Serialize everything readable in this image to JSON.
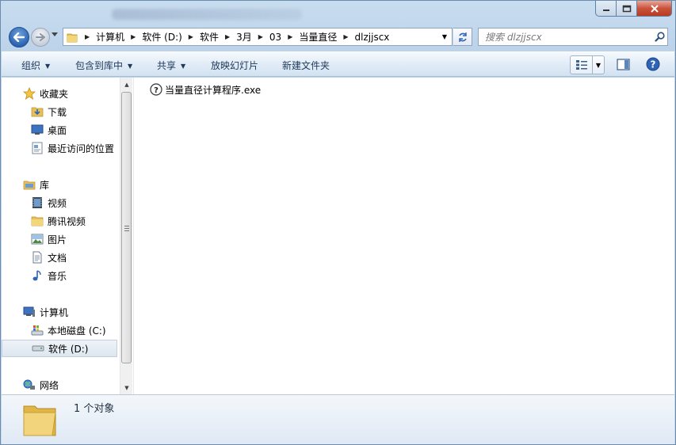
{
  "window": {
    "caption_buttons": {
      "minimize": "minimize-icon",
      "maximize": "maximize-icon",
      "close": "close-icon"
    }
  },
  "address": {
    "crumbs": [
      "计算机",
      "软件 (D:)",
      "软件",
      "3月",
      "03",
      "当量直径",
      "dlzjjscx"
    ]
  },
  "search": {
    "placeholder": "搜索 dlzjjscx"
  },
  "toolbar": {
    "organize": "组织",
    "include_in_library": "包含到库中",
    "share": "共享",
    "slideshow": "放映幻灯片",
    "new_folder": "新建文件夹"
  },
  "navpane": {
    "favorites": {
      "label": "收藏夹",
      "items": [
        "下载",
        "桌面",
        "最近访问的位置"
      ]
    },
    "libraries": {
      "label": "库",
      "items": [
        "视频",
        "腾讯视频",
        "图片",
        "文档",
        "音乐"
      ]
    },
    "computer": {
      "label": "计算机",
      "items": [
        "本地磁盘 (C:)",
        "软件 (D:)"
      ],
      "selected": "软件 (D:)"
    },
    "network": {
      "label": "网络"
    }
  },
  "files": [
    {
      "name": "当量直径计算程序.exe",
      "icon": "help-question-icon"
    }
  ],
  "details": {
    "count_text": "1 个对象"
  },
  "colors": {
    "accent": "#1e395b",
    "frame": "#c4d8ec",
    "selection": "#dde6ef"
  }
}
